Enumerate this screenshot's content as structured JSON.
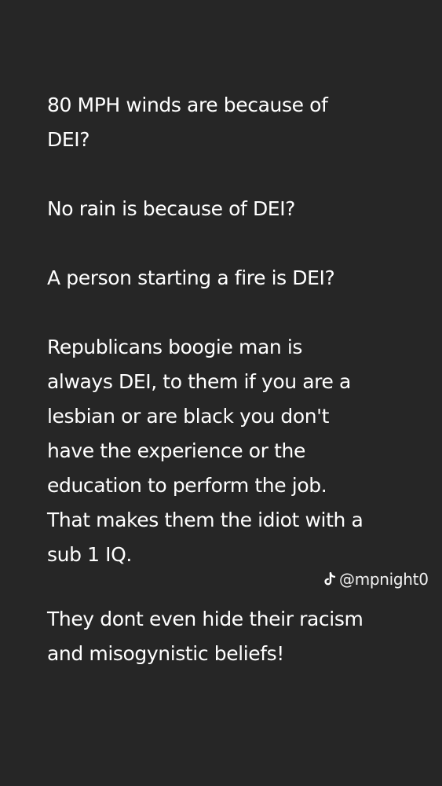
{
  "colors": {
    "background": "#262626",
    "text": "#ffffff"
  },
  "paragraphs": [
    {
      "lines": [
        "80 MPH winds are because of",
        "DEI?"
      ]
    },
    {
      "lines": [
        "No rain is because of DEI?"
      ]
    },
    {
      "lines": [
        "A person starting a fire is DEI?"
      ]
    },
    {
      "lines": [
        "Republicans boogie man is",
        "always DEI, to them if you are a",
        "lesbian or are black you don't",
        "have the experience or the",
        "education to perform the job.",
        "That makes them the idiot with a",
        "sub 1 IQ."
      ]
    }
  ],
  "watermark": {
    "icon": "tiktok-icon",
    "handle": "@mpnight0"
  },
  "closing": {
    "lines": [
      "They dont even hide their racism",
      "and misogynistic beliefs!"
    ]
  }
}
